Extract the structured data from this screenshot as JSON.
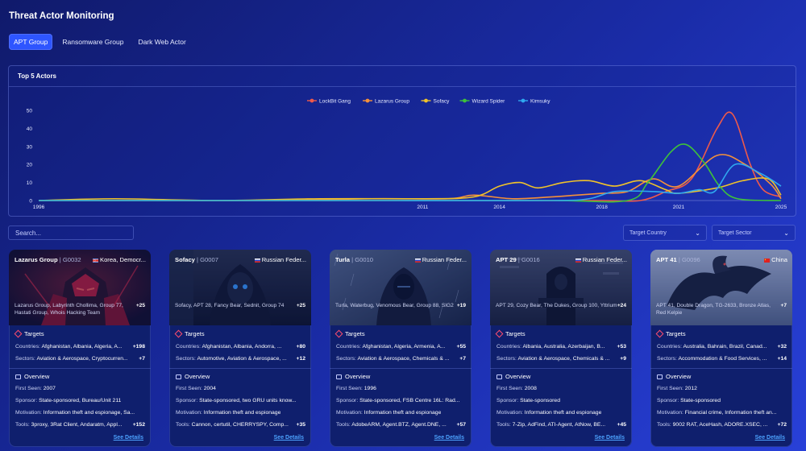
{
  "page": {
    "title": "Threat Actor Monitoring"
  },
  "tabs": [
    {
      "label": "APT Group",
      "active": true
    },
    {
      "label": "Ransomware Group",
      "active": false
    },
    {
      "label": "Dark Web Actor",
      "active": false
    }
  ],
  "chart_card": {
    "title": "Top 5 Actors"
  },
  "chart_data": {
    "type": "line",
    "title": "Top 5 Actors",
    "xlabel": "",
    "ylabel": "",
    "xlim": [
      1996,
      2025
    ],
    "ylim": [
      0,
      50
    ],
    "x_ticks": [
      1996,
      2011,
      2014,
      2018,
      2021,
      2025
    ],
    "y_ticks": [
      0,
      10,
      20,
      30,
      40,
      50
    ],
    "legend_position": "top-center",
    "grid": false,
    "series": [
      {
        "name": "LockBit Gang",
        "color": "#f05a4a",
        "points": [
          [
            1996,
            0
          ],
          [
            2000,
            0
          ],
          [
            2005,
            0
          ],
          [
            2010,
            0
          ],
          [
            2014,
            0
          ],
          [
            2016,
            0
          ],
          [
            2018,
            0
          ],
          [
            2019.5,
            0
          ],
          [
            2020.5,
            5
          ],
          [
            2021.5,
            12
          ],
          [
            2022.5,
            40
          ],
          [
            2023.1,
            48
          ],
          [
            2023.8,
            20
          ],
          [
            2024.3,
            6
          ],
          [
            2025,
            2
          ]
        ]
      },
      {
        "name": "Lazarus Group",
        "color": "#f5913a",
        "points": [
          [
            1996,
            0
          ],
          [
            2000,
            0
          ],
          [
            2005,
            0
          ],
          [
            2009,
            1
          ],
          [
            2012,
            1
          ],
          [
            2013,
            3
          ],
          [
            2014.5,
            1
          ],
          [
            2016,
            2
          ],
          [
            2017,
            3
          ],
          [
            2018,
            4
          ],
          [
            2019,
            5
          ],
          [
            2020,
            12
          ],
          [
            2021,
            8
          ],
          [
            2022.5,
            25
          ],
          [
            2023.6,
            20
          ],
          [
            2024.6,
            9
          ],
          [
            2025,
            1
          ]
        ]
      },
      {
        "name": "Sofacy",
        "color": "#f0c22a",
        "points": [
          [
            1996,
            0
          ],
          [
            1999,
            1
          ],
          [
            2003,
            0
          ],
          [
            2007,
            1
          ],
          [
            2011,
            1
          ],
          [
            2013,
            2
          ],
          [
            2014,
            8
          ],
          [
            2014.8,
            10
          ],
          [
            2015.5,
            7
          ],
          [
            2016.5,
            10
          ],
          [
            2017.5,
            11
          ],
          [
            2018.5,
            8
          ],
          [
            2019.5,
            11
          ],
          [
            2020.5,
            6
          ],
          [
            2021,
            4
          ],
          [
            2022.5,
            7
          ],
          [
            2023.5,
            11
          ],
          [
            2024.5,
            12
          ],
          [
            2025,
            3
          ]
        ]
      },
      {
        "name": "Wizard Spider",
        "color": "#3ec23a",
        "points": [
          [
            1996,
            0
          ],
          [
            2010,
            0
          ],
          [
            2016,
            0
          ],
          [
            2019,
            0
          ],
          [
            2019.8,
            10
          ],
          [
            2020.7,
            27
          ],
          [
            2021.3,
            31
          ],
          [
            2022,
            21
          ],
          [
            2022.6,
            8
          ],
          [
            2023.3,
            1
          ],
          [
            2025,
            0
          ]
        ]
      },
      {
        "name": "Kimsuky",
        "color": "#2fa8f0",
        "points": [
          [
            1996,
            0
          ],
          [
            2005,
            0
          ],
          [
            2010,
            0
          ],
          [
            2016,
            0
          ],
          [
            2017.5,
            1
          ],
          [
            2018.5,
            5
          ],
          [
            2020,
            5
          ],
          [
            2021,
            4
          ],
          [
            2021.8,
            6
          ],
          [
            2022.4,
            5
          ],
          [
            2023.2,
            20
          ],
          [
            2024.2,
            15
          ],
          [
            2025,
            8
          ]
        ]
      }
    ]
  },
  "search": {
    "placeholder": "Search..."
  },
  "filters": {
    "country_placeholder": "Target Country",
    "sector_placeholder": "Target Sector"
  },
  "labels": {
    "targets": "Targets",
    "overview": "Overview",
    "countries": "Countries:",
    "sectors": "Sectors:",
    "first_seen": "First Seen:",
    "sponsor": "Sponsor:",
    "motivation": "Motivation:",
    "tools": "Tools:",
    "see_details": "See Details"
  },
  "cards": [
    {
      "name": "Lazarus Group",
      "id": "G0032",
      "country": "Korea, Democr...",
      "flag": "korea",
      "aliases": "Lazarus Group, Labyrinth Chollima, Group 77, Hastati Group, Whois Hacking Team",
      "aliases_more": "+25",
      "countries": "Afghanistan, Albania, Algeria, A...",
      "countries_more": "+198",
      "sectors": "Aviation & Aerospace, Cryptocurren...",
      "sectors_more": "+7",
      "first_seen": "2007",
      "sponsor": "State-sponsored, Bureau/Unit 211",
      "motivation": "Information theft and espionage, Sa...",
      "tools": "3proxy, 3Rat Client, Andaratm, Appl...",
      "tools_more": "+152",
      "image": "red-armor"
    },
    {
      "name": "Sofacy",
      "id": "G0007",
      "country": "Russian Feder...",
      "flag": "russia",
      "aliases": "Sofacy, APT 28, Fancy Bear, Sednit, Group 74",
      "aliases_more": "+25",
      "countries": "Afghanistan, Albania, Andorra, ...",
      "countries_more": "+80",
      "sectors": "Automotive, Aviation & Aerospace, ...",
      "sectors_more": "+12",
      "first_seen": "2004",
      "sponsor": "State-sponsored, two GRU units know...",
      "motivation": "Information theft and espionage",
      "tools": "Cannon, certutil, CHERRYSPY, Comp...",
      "tools_more": "+35",
      "image": "hooded-figure"
    },
    {
      "name": "Turla",
      "id": "G0010",
      "country": "Russian Feder...",
      "flag": "russia",
      "aliases": "Turla, Waterbug, Venomous Bear, Group 88, SIG2",
      "aliases_more": "+19",
      "countries": "Afghanistan, Algeria, Armenia, A...",
      "countries_more": "+55",
      "sectors": "Aviation & Aerospace, Chemicals & ...",
      "sectors_more": "+7",
      "first_seen": "1996",
      "sponsor": "State-sponsored, FSB Centre 16L: Rad...",
      "motivation": "Information theft and espionage",
      "tools": "AdobeARM, Agent.BTZ, Agent.DNE, ...",
      "tools_more": "+57",
      "image": "hooded-rain"
    },
    {
      "name": "APT 29",
      "id": "G0016",
      "country": "Russian Feder...",
      "flag": "russia",
      "aliases": "APT 29, Cozy Bear, The Dukes, Group 100, Yttrium",
      "aliases_more": "+24",
      "countries": "Albania, Australia, Azerbaijan, B...",
      "countries_more": "+53",
      "sectors": "Aviation & Aerospace, Chemicals & ...",
      "sectors_more": "+9",
      "first_seen": "2008",
      "sponsor": "State-sponsored",
      "motivation": "Information theft and espionage",
      "tools": "7-Zip, AdFind, ATI-Agent, AtNow, BE...",
      "tools_more": "+45",
      "image": "throne"
    },
    {
      "name": "APT 41",
      "id": "G0096",
      "country": "China",
      "flag": "china",
      "aliases": "APT 41, Double Dragon, TG-2633, Bronze Atlas, Red Kelpie",
      "aliases_more": "+7",
      "countries": "Australia, Bahrain, Brazil, Canad...",
      "countries_more": "+32",
      "sectors": "Accommodation & Food Services, ...",
      "sectors_more": "+14",
      "first_seen": "2012",
      "sponsor": "State-sponsored",
      "motivation": "Financial crime, Information theft an...",
      "tools": "9002 RAT, AceHash, ADORE.XSEC, ...",
      "tools_more": "+72",
      "image": "dragon"
    }
  ]
}
